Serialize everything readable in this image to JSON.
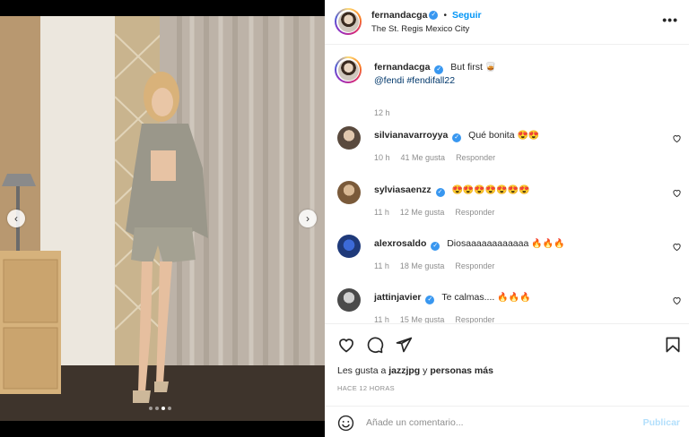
{
  "post": {
    "author": "fernandacga",
    "follow_label": "Seguir",
    "separator": "•",
    "location": "The St. Regis Mexico City",
    "more_label": "•••",
    "caption": {
      "text": "But first",
      "emoji": "🥃",
      "tags": "@fendi #fendifall22",
      "time": "12 h"
    },
    "carousel": {
      "prev_label": "‹",
      "next_label": "›",
      "slide_count": 4,
      "active_index": 2
    }
  },
  "comments": [
    {
      "username": "silvianavarroyya",
      "text": "Qué bonita",
      "emoji": "😍😍",
      "time": "10 h",
      "likes": "41 Me gusta",
      "reply": "Responder",
      "avatar_color": "#5a4a3e"
    },
    {
      "username": "sylviasaenzz",
      "text": "",
      "emoji": "😍😍😍😍😍😍😍",
      "time": "11 h",
      "likes": "12 Me gusta",
      "reply": "Responder",
      "avatar_color": "#7a5a3a"
    },
    {
      "username": "alexrosaldo",
      "text": "Diosaaaaaaaaaaaa",
      "emoji": "🔥🔥🔥",
      "time": "11 h",
      "likes": "18 Me gusta",
      "reply": "Responder",
      "avatar_color": "#1f3a7a"
    },
    {
      "username": "jattinjavier",
      "text": "Te calmas....",
      "emoji": "🔥🔥🔥",
      "time": "11 h",
      "likes": "15 Me gusta",
      "reply": "Responder",
      "avatar_color": "#4a4a4a"
    }
  ],
  "actions": {
    "likes_prefix": "Les gusta a",
    "likes_user": "jazzjpg",
    "likes_conjunction": "y",
    "likes_others": "personas más",
    "posted": "HACE 12 HORAS"
  },
  "composer": {
    "placeholder": "Añade un comentario...",
    "publish_label": "Publicar"
  },
  "colors": {
    "link_blue": "#0095f6",
    "verified_blue": "#3897f0",
    "tag_blue": "#00376b",
    "muted_gray": "#8e8e8e",
    "publish_disabled": "#b2dffc"
  }
}
